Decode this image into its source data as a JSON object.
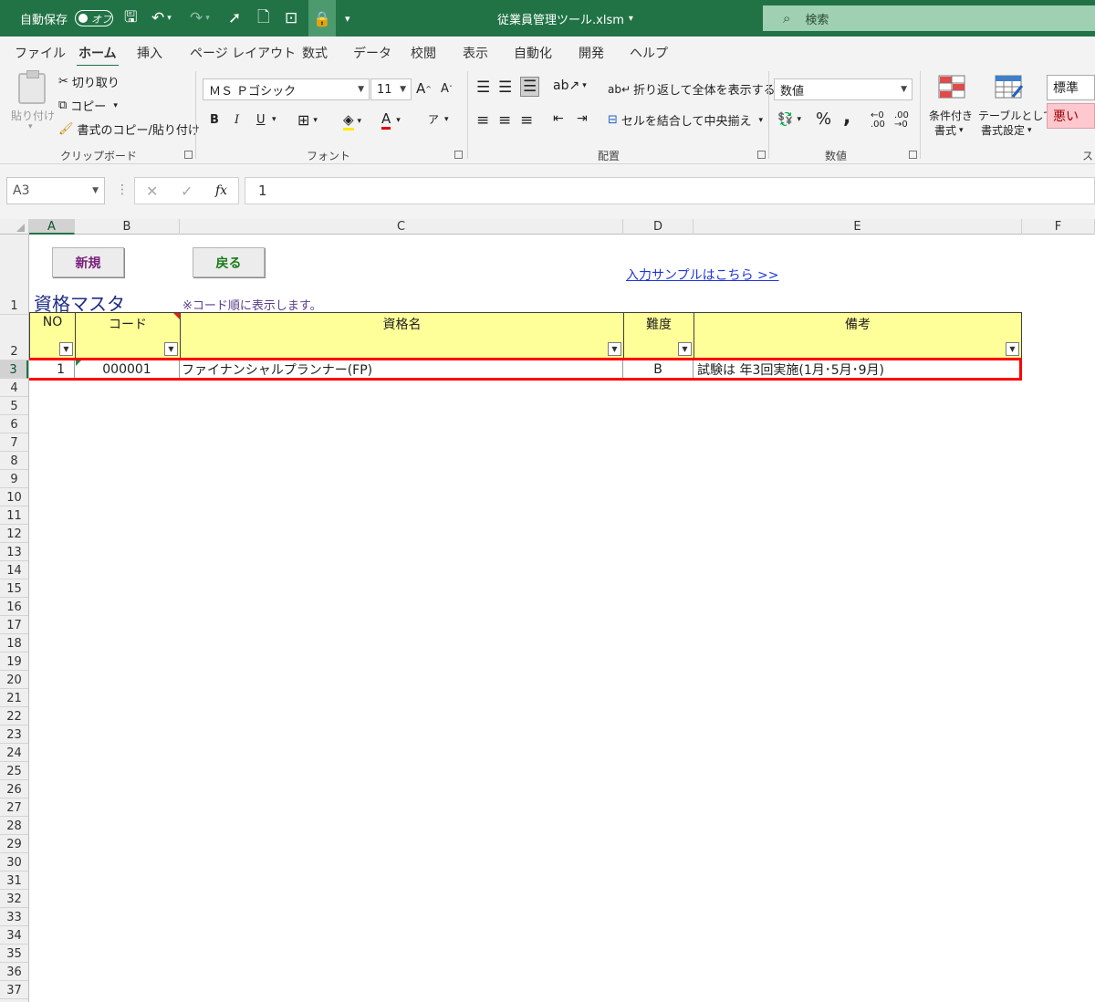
{
  "titlebar": {
    "autosave_label": "自動保存",
    "autosave_state": "オフ",
    "filename": "従業員管理ツール.xlsm",
    "search_placeholder": "検索",
    "bg_color": "#217346"
  },
  "menu": {
    "tabs": [
      "ファイル",
      "ホーム",
      "挿入",
      "ページ レイアウト",
      "数式",
      "データ",
      "校閲",
      "表示",
      "自動化",
      "開発",
      "ヘルプ"
    ],
    "active_tab": "ホーム"
  },
  "ribbon": {
    "clipboard": {
      "paste": "貼り付け",
      "cut": "切り取り",
      "copy": "コピー",
      "format_painter": "書式のコピー/貼り付け",
      "label": "クリップボード"
    },
    "font": {
      "font_name": "ＭＳ Ｐゴシック",
      "font_size": "11",
      "bold": "B",
      "italic": "I",
      "underline": "U",
      "label": "フォント"
    },
    "alignment": {
      "wrap_text": "折り返して全体を表示する",
      "merge_center": "セルを結合して中央揃え",
      "label": "配置"
    },
    "number": {
      "format": "数値",
      "percent": "%",
      "comma": ",",
      "label": "数値"
    },
    "styles": {
      "conditional_line1": "条件付き",
      "conditional_line2": "書式",
      "table_line1": "テーブルとして",
      "table_line2": "書式設定",
      "normal": "標準",
      "bad": "悪い",
      "label_partial": "ス"
    }
  },
  "formula_bar": {
    "name_box": "A3",
    "fx": "fx",
    "value": "1"
  },
  "columns": [
    "A",
    "B",
    "C",
    "D",
    "E",
    "F"
  ],
  "rows": [
    "1",
    "2",
    "3",
    "4",
    "5",
    "6",
    "7",
    "8",
    "9",
    "10",
    "11",
    "12",
    "13",
    "14",
    "15",
    "16",
    "17",
    "18",
    "19",
    "20",
    "21",
    "22",
    "23",
    "24",
    "25",
    "26",
    "27",
    "28",
    "29",
    "30",
    "31",
    "32",
    "33",
    "34",
    "35",
    "36",
    "37"
  ],
  "sheet": {
    "btn_new": "新規",
    "btn_back": "戻る",
    "title": "資格マスタ",
    "note": "※コード順に表示します。",
    "sample_link": "入力サンプルはこちら >>",
    "headers": {
      "no": "NO",
      "code": "コード",
      "name": "資格名",
      "difficulty": "難度",
      "remarks": "備考"
    },
    "row": {
      "no": "1",
      "code": "000001",
      "name": "ファイナンシャルプランナー(FP)",
      "difficulty": "B",
      "remarks": "試験は 年3回実施(1月･5月･9月)"
    },
    "header_fill": "#ffff99",
    "highlight_color": "#ff0000"
  }
}
